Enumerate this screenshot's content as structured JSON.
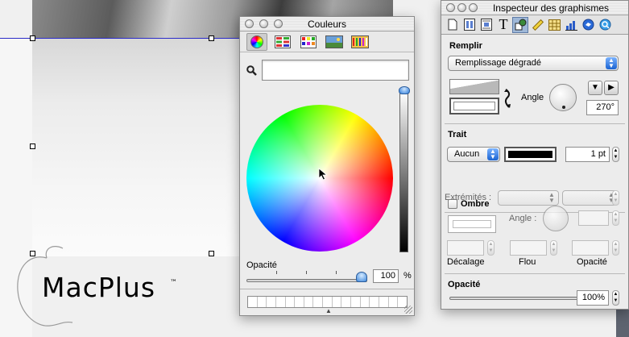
{
  "document": {
    "logo_text": "MacPlus",
    "logo_trademark": "™"
  },
  "couleurs": {
    "title": "Couleurs",
    "tabs": [
      {
        "icon": "color-wheel-icon",
        "selected": true
      },
      {
        "icon": "color-sliders-icon",
        "selected": false
      },
      {
        "icon": "color-palettes-icon",
        "selected": false
      },
      {
        "icon": "image-palettes-icon",
        "selected": false
      },
      {
        "icon": "crayons-icon",
        "selected": false
      }
    ],
    "search_value": "",
    "opacity_label": "Opacité",
    "opacity_value": "100",
    "opacity_unit": "%",
    "opacity_level": 1.0,
    "brightness_level": 1.0
  },
  "inspecteur": {
    "title": "Inspecteur des graphismes",
    "toolbar_icons": [
      "document-icon",
      "layout-icon",
      "wrap-icon",
      "text-icon",
      "graphic-icon",
      "metrics-icon",
      "table-icon",
      "chart-icon",
      "link-icon",
      "quicktime-icon"
    ],
    "selected_tool": "graphic-icon",
    "fill": {
      "section_label": "Remplir",
      "fill_type": "Remplissage dégradé",
      "angle_label": "Angle",
      "angle_value": "270°"
    },
    "stroke": {
      "section_label": "Trait",
      "stroke_style": "Aucun",
      "color": "#000000",
      "width_value": "1 pt",
      "endpoints_label": "Extrémités :"
    },
    "shadow": {
      "section_label": "Ombre",
      "checked": false,
      "angle_label": "Angle :",
      "offset_label": "Décalage",
      "blur_label": "Flou",
      "opacity_label": "Opacité"
    },
    "opacity": {
      "section_label": "Opacité",
      "value": "100%",
      "level": 1.0
    }
  },
  "colors": {
    "selection_blue": "#2a2ac8",
    "knob_blue": "#3f88dc",
    "popup_blue": "#1a63d1"
  }
}
